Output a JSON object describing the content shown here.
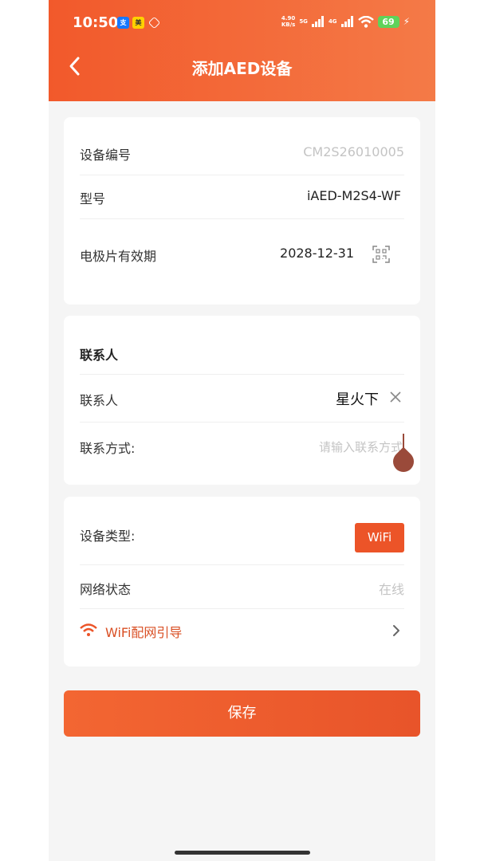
{
  "status_bar": {
    "time": "10:50",
    "net_speed_value": "4.90",
    "net_speed_unit": "KB/s",
    "signal1_label": "5G",
    "signal2_label": "4G",
    "battery": "69"
  },
  "header": {
    "title": "添加AED设备"
  },
  "device_card": {
    "serial_label": "设备编号",
    "serial_value": "CM2S26010005",
    "model_label": "型号",
    "model_value": "iAED-M2S4-WF",
    "expiry_label": "电极片有效期",
    "expiry_value": "2028-12-31"
  },
  "contact_card": {
    "section_title": "联系人",
    "contact_label": "联系人",
    "contact_value": "星火下",
    "method_label": "联系方式:",
    "method_placeholder": "请输入联系方式"
  },
  "network_card": {
    "type_label": "设备类型:",
    "type_value": "WiFi",
    "status_label": "网络状态",
    "status_value": "在线",
    "wifi_guide_label": "WiFi配网引导"
  },
  "save_label": "保存",
  "colors": {
    "accent": "#f05a2a",
    "header_start": "#f2592b",
    "header_end": "#f47a47",
    "cursor": "#9a4a3a"
  }
}
